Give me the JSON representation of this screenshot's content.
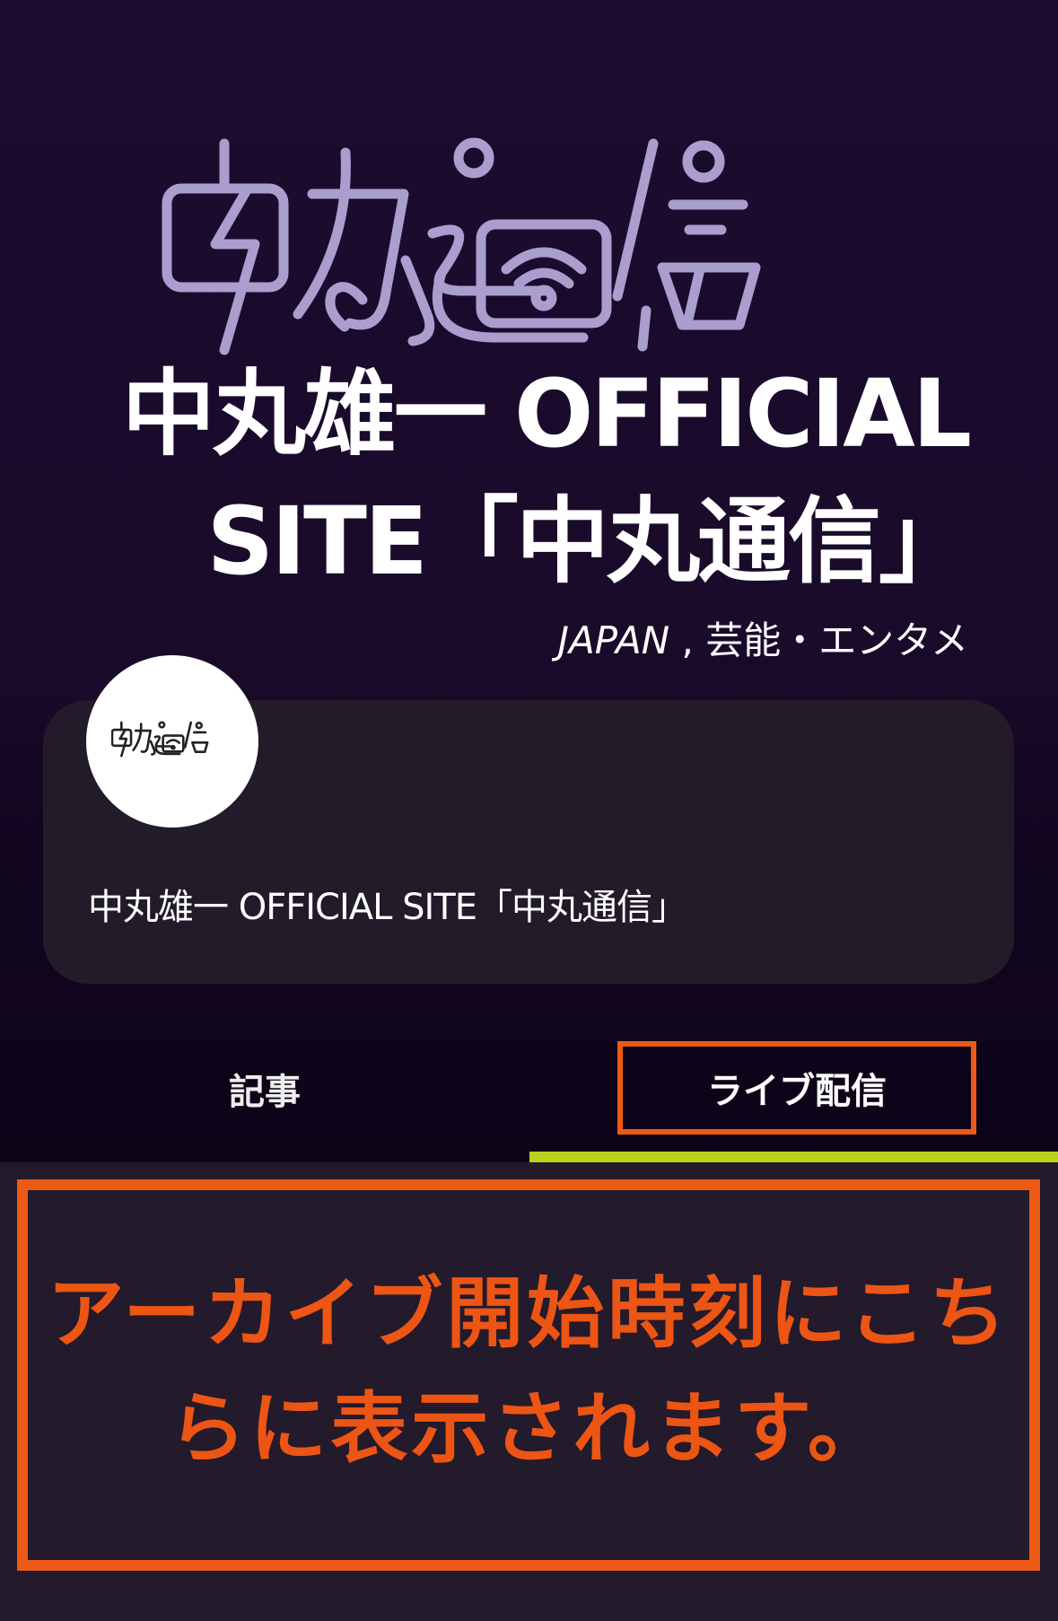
{
  "header": {
    "logo_icon": "nakamaru-tsushin-logo-icon",
    "site_title": "中丸雄一 OFFICIAL SITE「中丸通信」",
    "region": "JAPAN",
    "region_separator": " , ",
    "category": "芸能・エンタメ"
  },
  "profile_card": {
    "avatar_icon": "nakamaru-tsushin-logo-icon",
    "name": "中丸雄一 OFFICIAL SITE「中丸通信」"
  },
  "tabs": [
    {
      "label": "記事",
      "selected": false
    },
    {
      "label": "ライブ配信",
      "selected": true
    }
  ],
  "live_panel": {
    "message": "アーカイブ開始時刻にこちらに表示されます。"
  },
  "colors": {
    "accent_orange": "#ee5a16",
    "tab_indicator": "#b7d31c",
    "background_dark": "#1a0b2c",
    "card_background": "#221b2a"
  }
}
